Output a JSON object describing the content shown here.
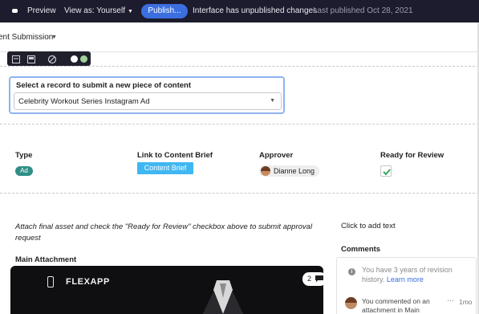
{
  "topbar": {
    "preview_label": "Preview",
    "view_as_label": "View as: Yourself",
    "publish_label": "Publish...",
    "unpublished_text": "Interface has unpublished changes",
    "last_published_text": "Last published Oct 28, 2021"
  },
  "page": {
    "title": "ent Submission"
  },
  "element_toolbar": {
    "icons": [
      "layout-top-icon",
      "layout-bottom-icon",
      "hide-icon",
      "white-swatch",
      "green-swatch"
    ]
  },
  "record_picker": {
    "label": "Select a record to submit a new piece of content",
    "selected_value": "Celebrity Workout Series Instagram Ad"
  },
  "fields": {
    "type_label": "Type",
    "type_value": "Ad",
    "brief_label": "Link to Content Brief",
    "brief_button": "Content Brief",
    "approver_label": "Approver",
    "approver_name": "Dianne Long",
    "ready_label": "Ready for Review",
    "ready_checked": true
  },
  "instructions": "Attach final asset and check the \"Ready for Review\" checkbox above to submit approval request",
  "click_to_add_text": "Click to add text",
  "main_attachment": {
    "heading": "Main Attachment",
    "brand_text": "FLEXAPP",
    "comment_count": "2"
  },
  "comments": {
    "heading": "Comments",
    "info_text": "You have 3 years of revision history.",
    "info_link": "Learn more",
    "entry_text": "You commented on an attachment in Main",
    "entry_more": "···",
    "entry_time": "1mo"
  },
  "colors": {
    "topbar_bg": "#1c1c2e",
    "publish_button": "#3b6fe0",
    "type_tag": "#2e8f86",
    "brief_button": "#3fb7f2",
    "checkbox_check": "#3aa564"
  }
}
